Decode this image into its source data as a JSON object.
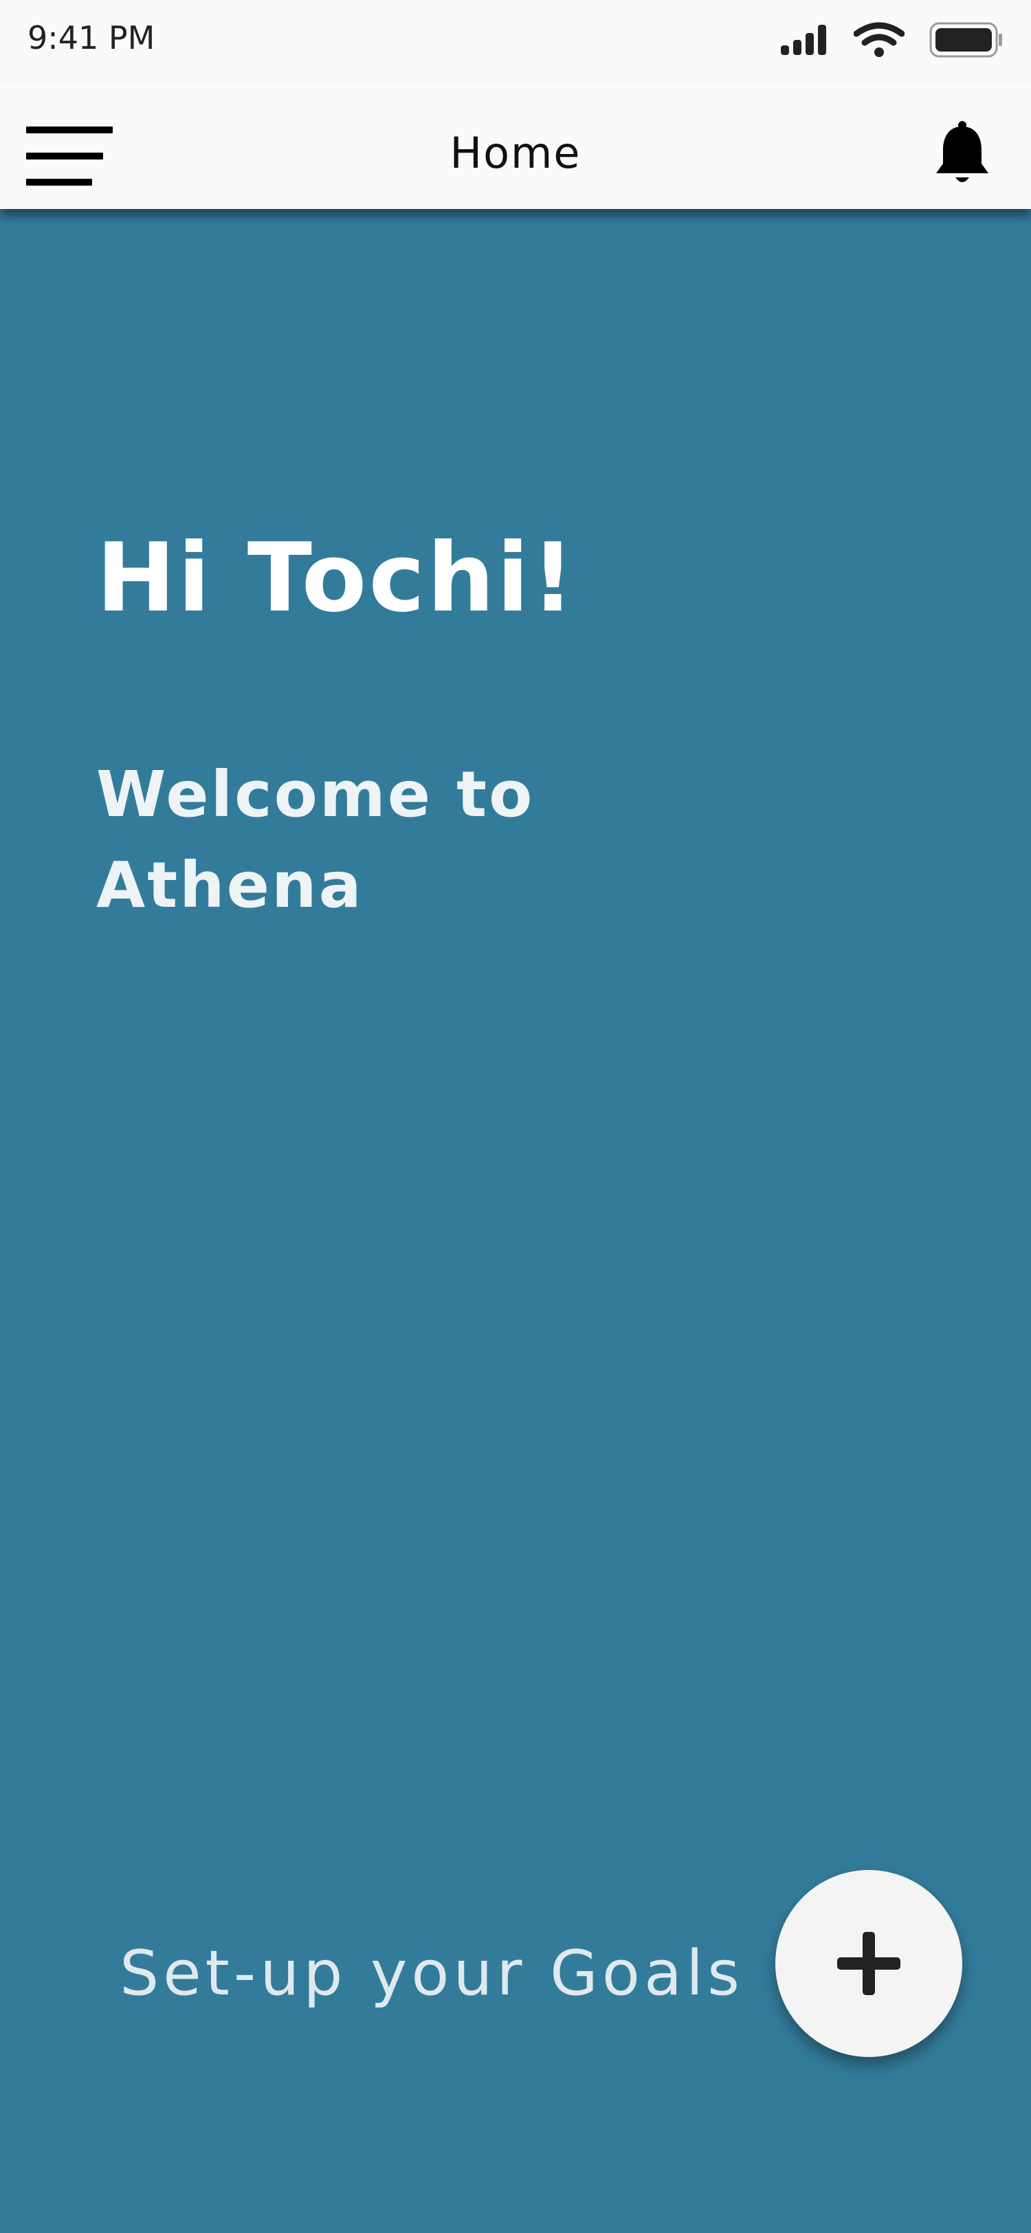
{
  "status_bar": {
    "time": "9:41 PM"
  },
  "app_bar": {
    "title": "Home"
  },
  "main": {
    "greeting": "Hi Tochi!",
    "welcome_line1": "Welcome to",
    "welcome_line2": "Athena",
    "setup_goals_label": "Set-up your Goals"
  },
  "icons": {
    "menu": "hamburger-menu-icon",
    "notifications": "bell-icon",
    "add": "plus-icon",
    "signal": "cellular-signal-icon",
    "wifi": "wifi-icon",
    "battery": "battery-icon"
  },
  "colors": {
    "background": "#337b9b",
    "app_bar": "#fafafa",
    "fab": "#f4f4f4",
    "fab_icon": "#222222"
  }
}
